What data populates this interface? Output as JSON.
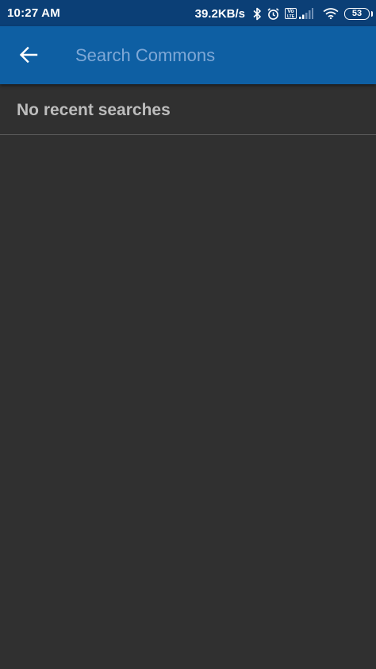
{
  "status_bar": {
    "time": "10:27 AM",
    "net_speed": "39.2KB/s",
    "volte_line1": "Vo",
    "volte_line2": "LTE",
    "battery_level": "53",
    "icons": [
      "bluetooth-icon",
      "alarm-icon",
      "volte-icon",
      "signal-icon",
      "wifi-icon",
      "battery-icon"
    ]
  },
  "app_bar": {
    "back_icon": "arrow-left-icon",
    "search_placeholder": "Search Commons",
    "search_value": "",
    "background_color": "#0e5fa3"
  },
  "recent": {
    "empty_message": "No recent searches"
  },
  "colors": {
    "status_bar": "#0b3f76",
    "background": "#303030",
    "placeholder": "#7fa8d6",
    "empty_text": "#bdbdbd"
  }
}
